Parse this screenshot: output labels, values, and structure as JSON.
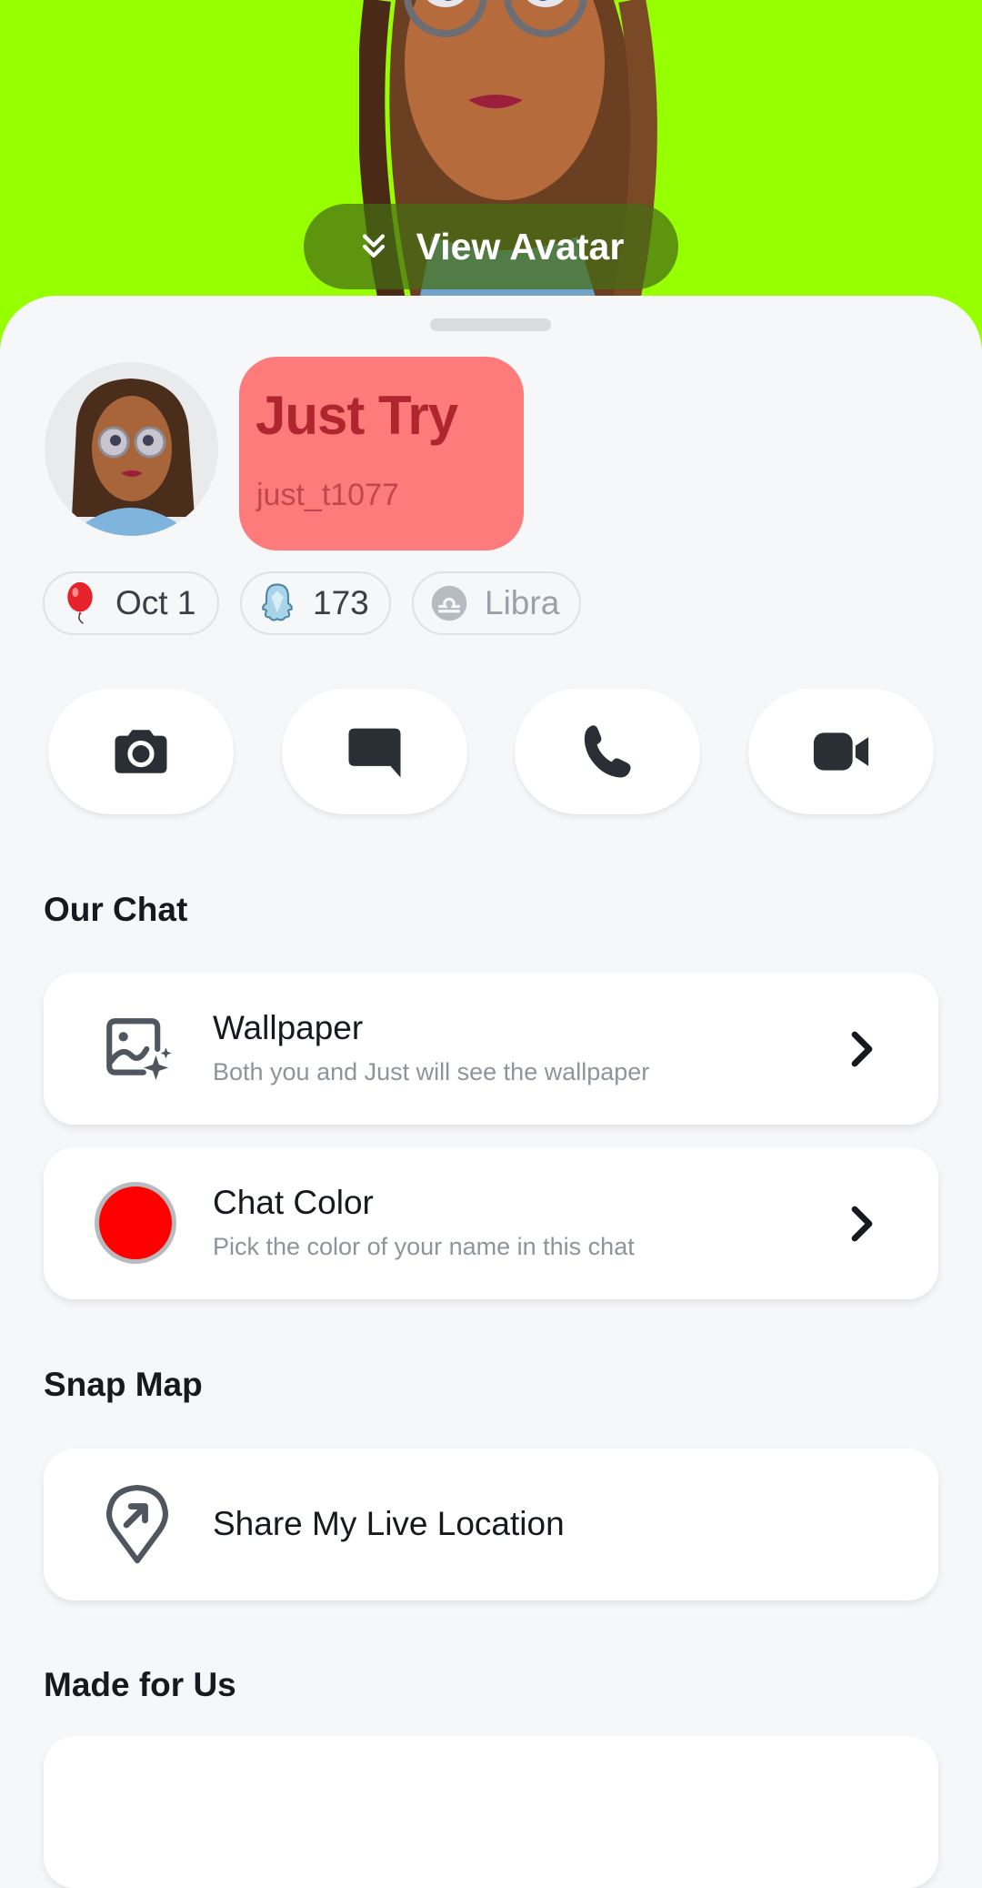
{
  "hero": {
    "background_color": "#96ff00",
    "view_avatar_label": "View Avatar",
    "view_avatar_icon": "chevron-double-down-icon"
  },
  "profile": {
    "display_name": "Just Try",
    "username": "just_t1077",
    "name_box_color": "#fe7b7b",
    "badges": [
      {
        "icon": "balloon-icon",
        "label": "Oct 1"
      },
      {
        "icon": "ghost-score-icon",
        "label": "173"
      },
      {
        "icon": "libra-icon",
        "label": "Libra"
      }
    ]
  },
  "actions": [
    {
      "icon": "camera-icon",
      "name": "Camera"
    },
    {
      "icon": "chat-icon",
      "name": "Chat"
    },
    {
      "icon": "phone-icon",
      "name": "Voice Call"
    },
    {
      "icon": "video-icon",
      "name": "Video Call"
    }
  ],
  "sections": {
    "our_chat": {
      "title": "Our Chat",
      "items": [
        {
          "icon": "wallpaper-icon",
          "title": "Wallpaper",
          "subtitle": "Both you and Just will see the wallpaper"
        },
        {
          "icon": "color-dot",
          "title": "Chat Color",
          "subtitle": "Pick the color of your name in this chat",
          "color": "#ff0000"
        }
      ]
    },
    "snap_map": {
      "title": "Snap Map",
      "items": [
        {
          "icon": "location-share-icon",
          "title": "Share My Live Location"
        }
      ]
    },
    "made_for_us": {
      "title": "Made for Us"
    }
  }
}
